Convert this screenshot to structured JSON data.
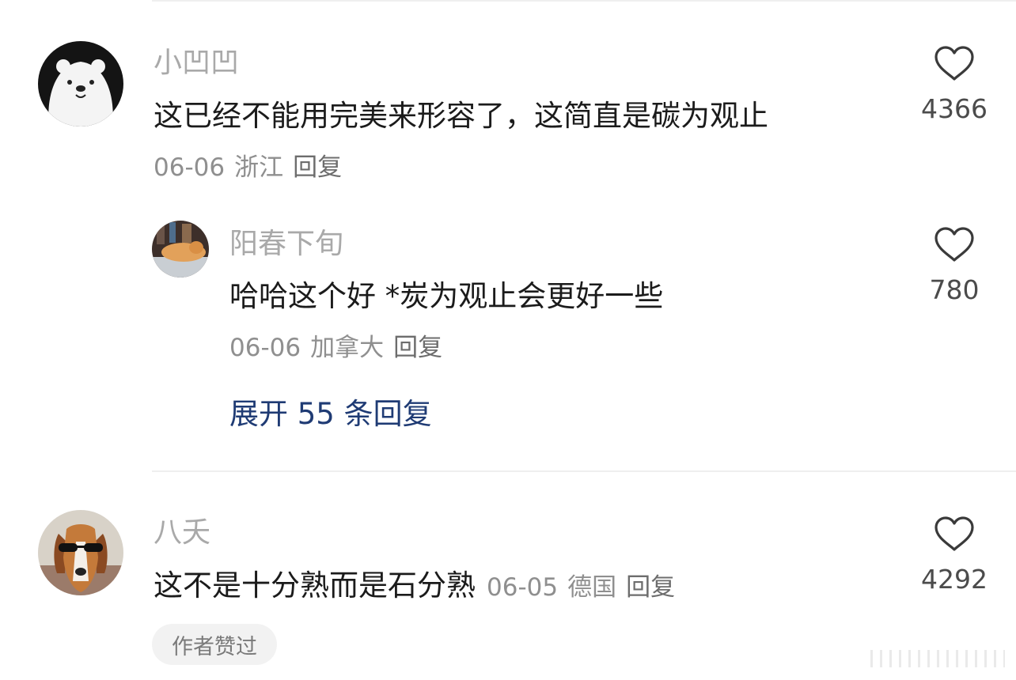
{
  "comments": [
    {
      "username": "小凹凹",
      "content": "这已经不能用完美来形容了，这简直是碳为观止",
      "date": "06-06",
      "location": "浙江",
      "reply_label": "回复",
      "like_count": "4366",
      "replies": [
        {
          "username": "阳春下旬",
          "content": "哈哈这个好 *炭为观止会更好一些",
          "date": "06-06",
          "location": "加拿大",
          "reply_label": "回复",
          "like_count": "780"
        }
      ],
      "expand_label": "展开 55 条回复"
    },
    {
      "username": "八夭",
      "content": "这不是十分熟而是石分熟",
      "date": "06-05",
      "location": "德国",
      "reply_label": "回复",
      "like_count": "4292",
      "badge": "作者赞过"
    }
  ],
  "icons": {
    "like": "heart-outline-icon"
  },
  "colors": {
    "link": "#1f3b74",
    "username": "#a9a9a9",
    "meta": "#8f8f8f",
    "text": "#1b1b1b"
  }
}
